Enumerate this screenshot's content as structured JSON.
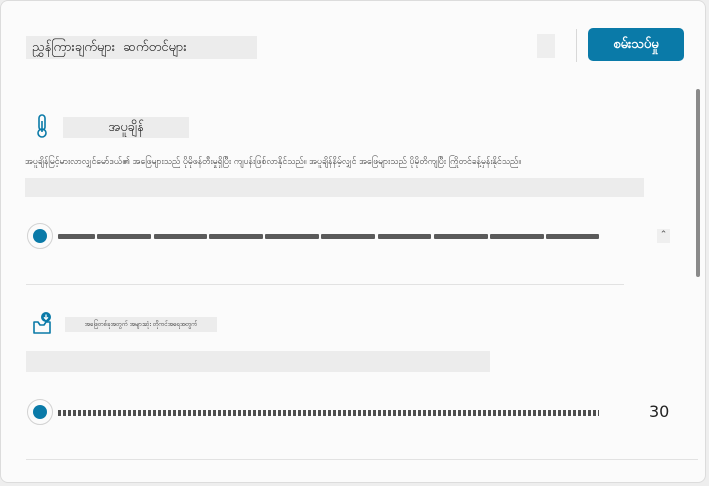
{
  "dialog": {
    "title": "ညွှန်ကြားချက်များ ⁠ ဆက်တင်များ",
    "help_glyph": "",
    "test_button_label": "စမ်းသပ်မှု"
  },
  "temperature": {
    "icon": "thermometer-icon",
    "title": "အပူချိန်",
    "description": "အပူချိန်မြင့်မားလာလျှင်မော်ဒယ်၏ အဖြေများသည် ပိုမိုဖန်တီးမှုရှိပြီး ကျပန်းဖြစ်လာနိုင်သည်။ အပူချိန်နိမ့်လျှင် အဖြေများသည် ပိုမိုတိကျပြီး ကြိုတင်ခန့်မှန်းနိုင်သည်။",
    "value_text": "",
    "collapse_glyph": "⌃",
    "level": 0.0,
    "color": "#0a7aa8"
  },
  "max_tokens": {
    "icon": "inbox-download-icon",
    "title": "အဖြေတစ်ခုအတွက် အများဆုံး တိုကင်အရေအတွက်",
    "value_text": "",
    "value": "30",
    "level": 0.0,
    "color": "#0a7aa8"
  }
}
